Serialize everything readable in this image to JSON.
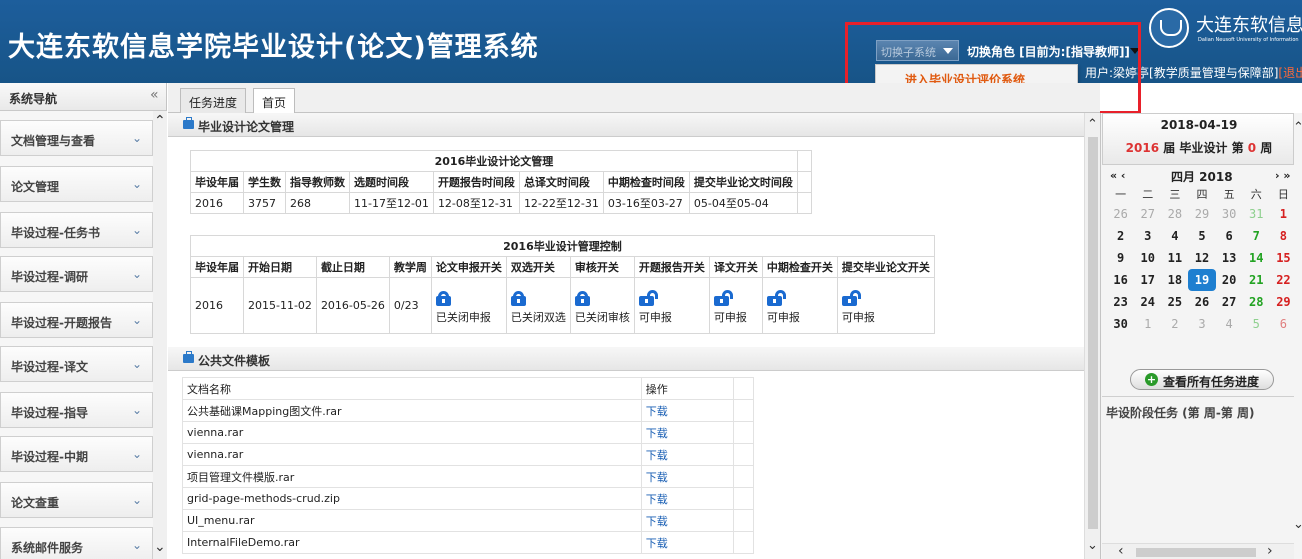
{
  "header": {
    "title": "大连东软信息学院毕业设计(论文)管理系统",
    "switch_system_label": "切换子系统",
    "switch_role_label": "切换角色 [目前为:[指导教师]]",
    "user_prefix": "用户:梁婷",
    "user_rest": "亭[教学质量管理与保障部]",
    "logout_label": "[退出",
    "logo_cn": "大连东软信息学院",
    "logo_en": "Dalian Neusoft University of Information",
    "dropdown_item": "进入毕业设计评价系统"
  },
  "sidebar": {
    "title": "系统导航",
    "items": [
      {
        "label": "文档管理与查看"
      },
      {
        "label": "论文管理"
      },
      {
        "label": "毕设过程-任务书"
      },
      {
        "label": "毕设过程-调研"
      },
      {
        "label": "毕设过程-开题报告"
      },
      {
        "label": "毕设过程-译文"
      },
      {
        "label": "毕设过程-指导"
      },
      {
        "label": "毕设过程-中期"
      },
      {
        "label": "论文查重"
      },
      {
        "label": "系统邮件服务"
      }
    ]
  },
  "tabs": [
    {
      "label": "任务进度",
      "active": false
    },
    {
      "label": "首页",
      "active": true
    }
  ],
  "thesis_panel": {
    "title": "毕业设计论文管理",
    "mgmt_caption": "2016毕业设计论文管理",
    "mgmt_headers": [
      "毕设年届",
      "学生数",
      "指导教师数",
      "选题时间段",
      "开题报告时间段",
      "总译文时间段",
      "中期检查时间段",
      "提交毕业论文时间段"
    ],
    "mgmt_row": [
      "2016",
      "3757",
      "268",
      "11-17至12-01",
      "12-08至12-31",
      "12-22至12-31",
      "03-16至03-27",
      "05-04至05-04"
    ],
    "ctrl_caption": "2016毕业设计管理控制",
    "ctrl_headers": [
      "毕设年届",
      "开始日期",
      "截止日期",
      "教学周",
      "论文申报开关",
      "双选开关",
      "审核开关",
      "开题报告开关",
      "译文开关",
      "中期检查开关",
      "提交毕业论文开关"
    ],
    "ctrl_row": [
      "2016",
      "2015-11-02",
      "2016-05-26",
      "0/23"
    ],
    "switches": [
      {
        "state": "closed",
        "label": "已关闭申报",
        "icon": "lock-closed-icon"
      },
      {
        "state": "closed",
        "label": "已关闭双选",
        "icon": "lock-closed-icon"
      },
      {
        "state": "closed",
        "label": "已关闭审核",
        "icon": "lock-closed-icon"
      },
      {
        "state": "open",
        "label": "可申报",
        "icon": "lock-open-icon"
      },
      {
        "state": "open",
        "label": "可申报",
        "icon": "lock-open-icon"
      },
      {
        "state": "open",
        "label": "可申报",
        "icon": "lock-open-icon"
      },
      {
        "state": "open",
        "label": "可申报",
        "icon": "lock-open-icon"
      }
    ]
  },
  "files_panel": {
    "title": "公共文件模板",
    "headers": [
      "文档名称",
      "操作"
    ],
    "rows": [
      {
        "name": "公共基础课Mapping图文件.rar",
        "action": "下载"
      },
      {
        "name": "vienna.rar",
        "action": "下载"
      },
      {
        "name": "vienna.rar",
        "action": "下载"
      },
      {
        "name": "项目管理文件模版.rar",
        "action": "下载"
      },
      {
        "name": "grid-page-methods-crud.zip",
        "action": "下载"
      },
      {
        "name": "UI_menu.rar",
        "action": "下载"
      },
      {
        "name": "InternalFileDemo.rar",
        "action": "下载"
      }
    ]
  },
  "right_panel": {
    "date": "2018-04-19",
    "grad_year": "2016",
    "grad_mid": " 届 毕业设计 第 ",
    "grad_week": "0",
    "grad_tail": " 周",
    "calendar": {
      "prev": "«  ‹",
      "month": "四月 2018",
      "next": "›  »",
      "weekdays": [
        "一",
        "二",
        "三",
        "四",
        "五",
        "六",
        "日"
      ],
      "weeks": [
        [
          "26",
          "27",
          "28",
          "29",
          "30",
          "31",
          "1"
        ],
        [
          "2",
          "3",
          "4",
          "5",
          "6",
          "7",
          "8"
        ],
        [
          "9",
          "10",
          "11",
          "12",
          "13",
          "14",
          "15"
        ],
        [
          "16",
          "17",
          "18",
          "19",
          "20",
          "21",
          "22"
        ],
        [
          "23",
          "24",
          "25",
          "26",
          "27",
          "28",
          "29"
        ],
        [
          "30",
          "1",
          "2",
          "3",
          "4",
          "5",
          "6"
        ]
      ],
      "today": "19"
    },
    "all_progress_label": "查看所有任务进度",
    "stage_tasks_title": "毕设阶段任务 (第 周-第 周)"
  },
  "colors": {
    "header_bg": "#1d5e9c",
    "accent_blue": "#1a6ad0",
    "highlight_red": "#e8202a",
    "dropdown_link": "#e05a10"
  }
}
